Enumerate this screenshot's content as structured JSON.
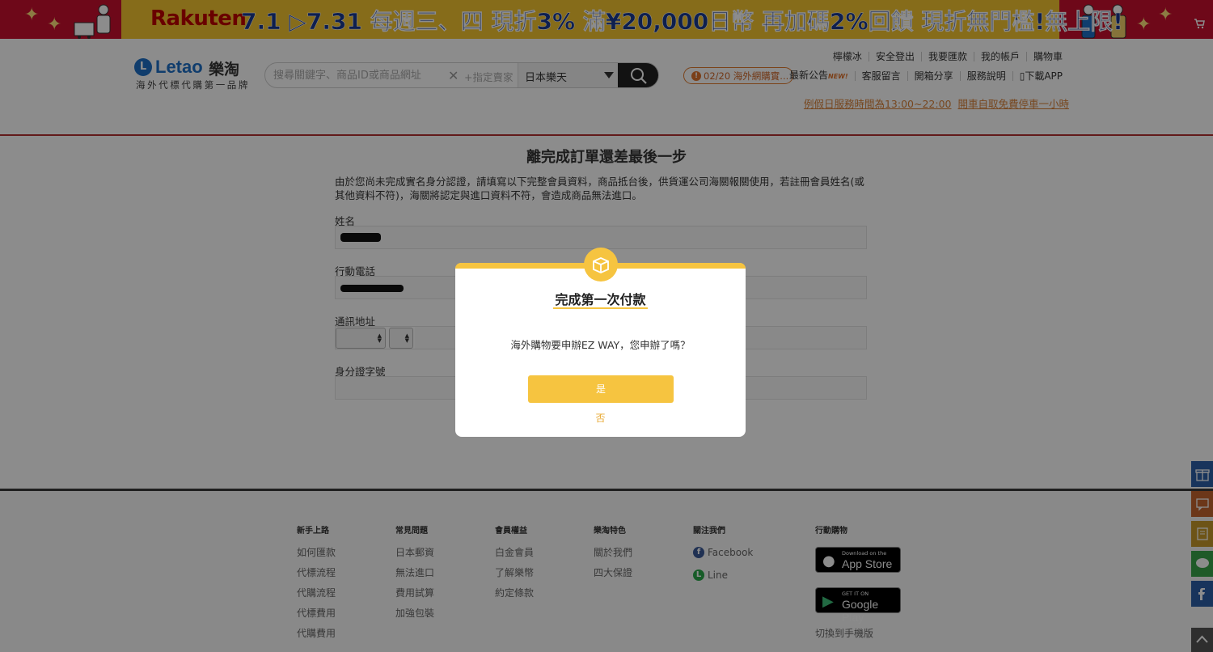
{
  "banner": {
    "brand": "Rakuten",
    "promo": "7.1 ▷7.31 每週三、四 現折3% 滿¥20,000日幣 再加碼2%回饋 現折無門檻!無上限!"
  },
  "header": {
    "logo_name": "Letao",
    "logo_name_zh": "樂淘",
    "logo_slogan": "海外代標代購第一品牌",
    "search_placeholder": "搜尋關鍵字、商品ID或商品網址",
    "seller_placeholder": "+指定賣家",
    "market": "日本樂天",
    "notice": "02/20 海外網購實...",
    "top_links": [
      "檸檬冰",
      "安全登出",
      "我要匯款",
      "我的帳戶",
      "購物車"
    ],
    "sub_links": [
      "最新公告",
      "客服留言",
      "開箱分享",
      "服務說明",
      "下載APP"
    ],
    "new_tag": "NEW!",
    "hours": [
      "例假日服務時間為13:00~22:00",
      "開車自取免費停車一小時"
    ]
  },
  "form": {
    "title": "離完成訂單還差最後一步",
    "description": "由於您尚未完成實名身分認證，請填寫以下完整會員資料，商品抵台後，供貨運公司海關報關使用，若註冊會員姓名(或其他資料不符)，海關將認定與進口資料不符，會造成商品無法進口。",
    "name_label": "姓名",
    "phone_label": "行動電話",
    "address_label": "通訊地址",
    "id_label": "身分證字號"
  },
  "footer": {
    "columns": [
      {
        "head": "新手上路",
        "items": [
          "如何匯款",
          "代標流程",
          "代購流程",
          "代標費用",
          "代購費用"
        ]
      },
      {
        "head": "常見問題",
        "items": [
          "日本郵資",
          "無法進口",
          "費用試算",
          "加強包裝"
        ]
      },
      {
        "head": "會員權益",
        "items": [
          "白金會員",
          "了解樂幣",
          "約定條款"
        ]
      },
      {
        "head": "樂淘特色",
        "items": [
          "關於我們",
          "四大保證"
        ]
      }
    ],
    "follow_head": "關注我們",
    "facebook": "Facebook",
    "line": "Line",
    "mobile_head": "行動購物",
    "appstore_small": "Download on the",
    "appstore_big": "App Store",
    "googleplay_small": "GET IT ON",
    "googleplay_big": "Google Play",
    "switch_mobile": "切換到手機版"
  },
  "modal": {
    "title": "完成第一次付款",
    "message": "海外購物要申辦EZ WAY，您申辦了嗎？",
    "yes": "是",
    "no": "否"
  },
  "colors": {
    "accent_yellow": "#f6c440",
    "header_rule": "#b23131",
    "link_orange": "#d9823a"
  }
}
